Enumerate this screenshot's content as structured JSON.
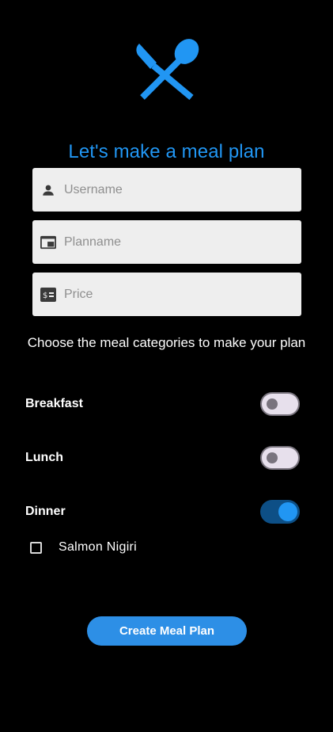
{
  "header": {
    "logo_icon": "fork-spoon-icon",
    "title": "Let's make a meal plan",
    "accent_color": "#2196f3"
  },
  "form": {
    "username": {
      "icon": "person-icon",
      "placeholder": "Username",
      "value": ""
    },
    "planname": {
      "icon": "picture-in-picture-icon",
      "placeholder": "Planname",
      "value": ""
    },
    "price": {
      "icon": "price-tag-icon",
      "placeholder": "Price",
      "value": ""
    }
  },
  "categories": {
    "prompt": "Choose the meal categories to make your plan",
    "items": [
      {
        "label": "Breakfast",
        "enabled": false
      },
      {
        "label": "Lunch",
        "enabled": false
      },
      {
        "label": "Dinner",
        "enabled": true
      }
    ]
  },
  "dinner_options": [
    {
      "label": "Salmon Nigiri",
      "checked": false
    }
  ],
  "actions": {
    "create_label": "Create Meal Plan"
  }
}
